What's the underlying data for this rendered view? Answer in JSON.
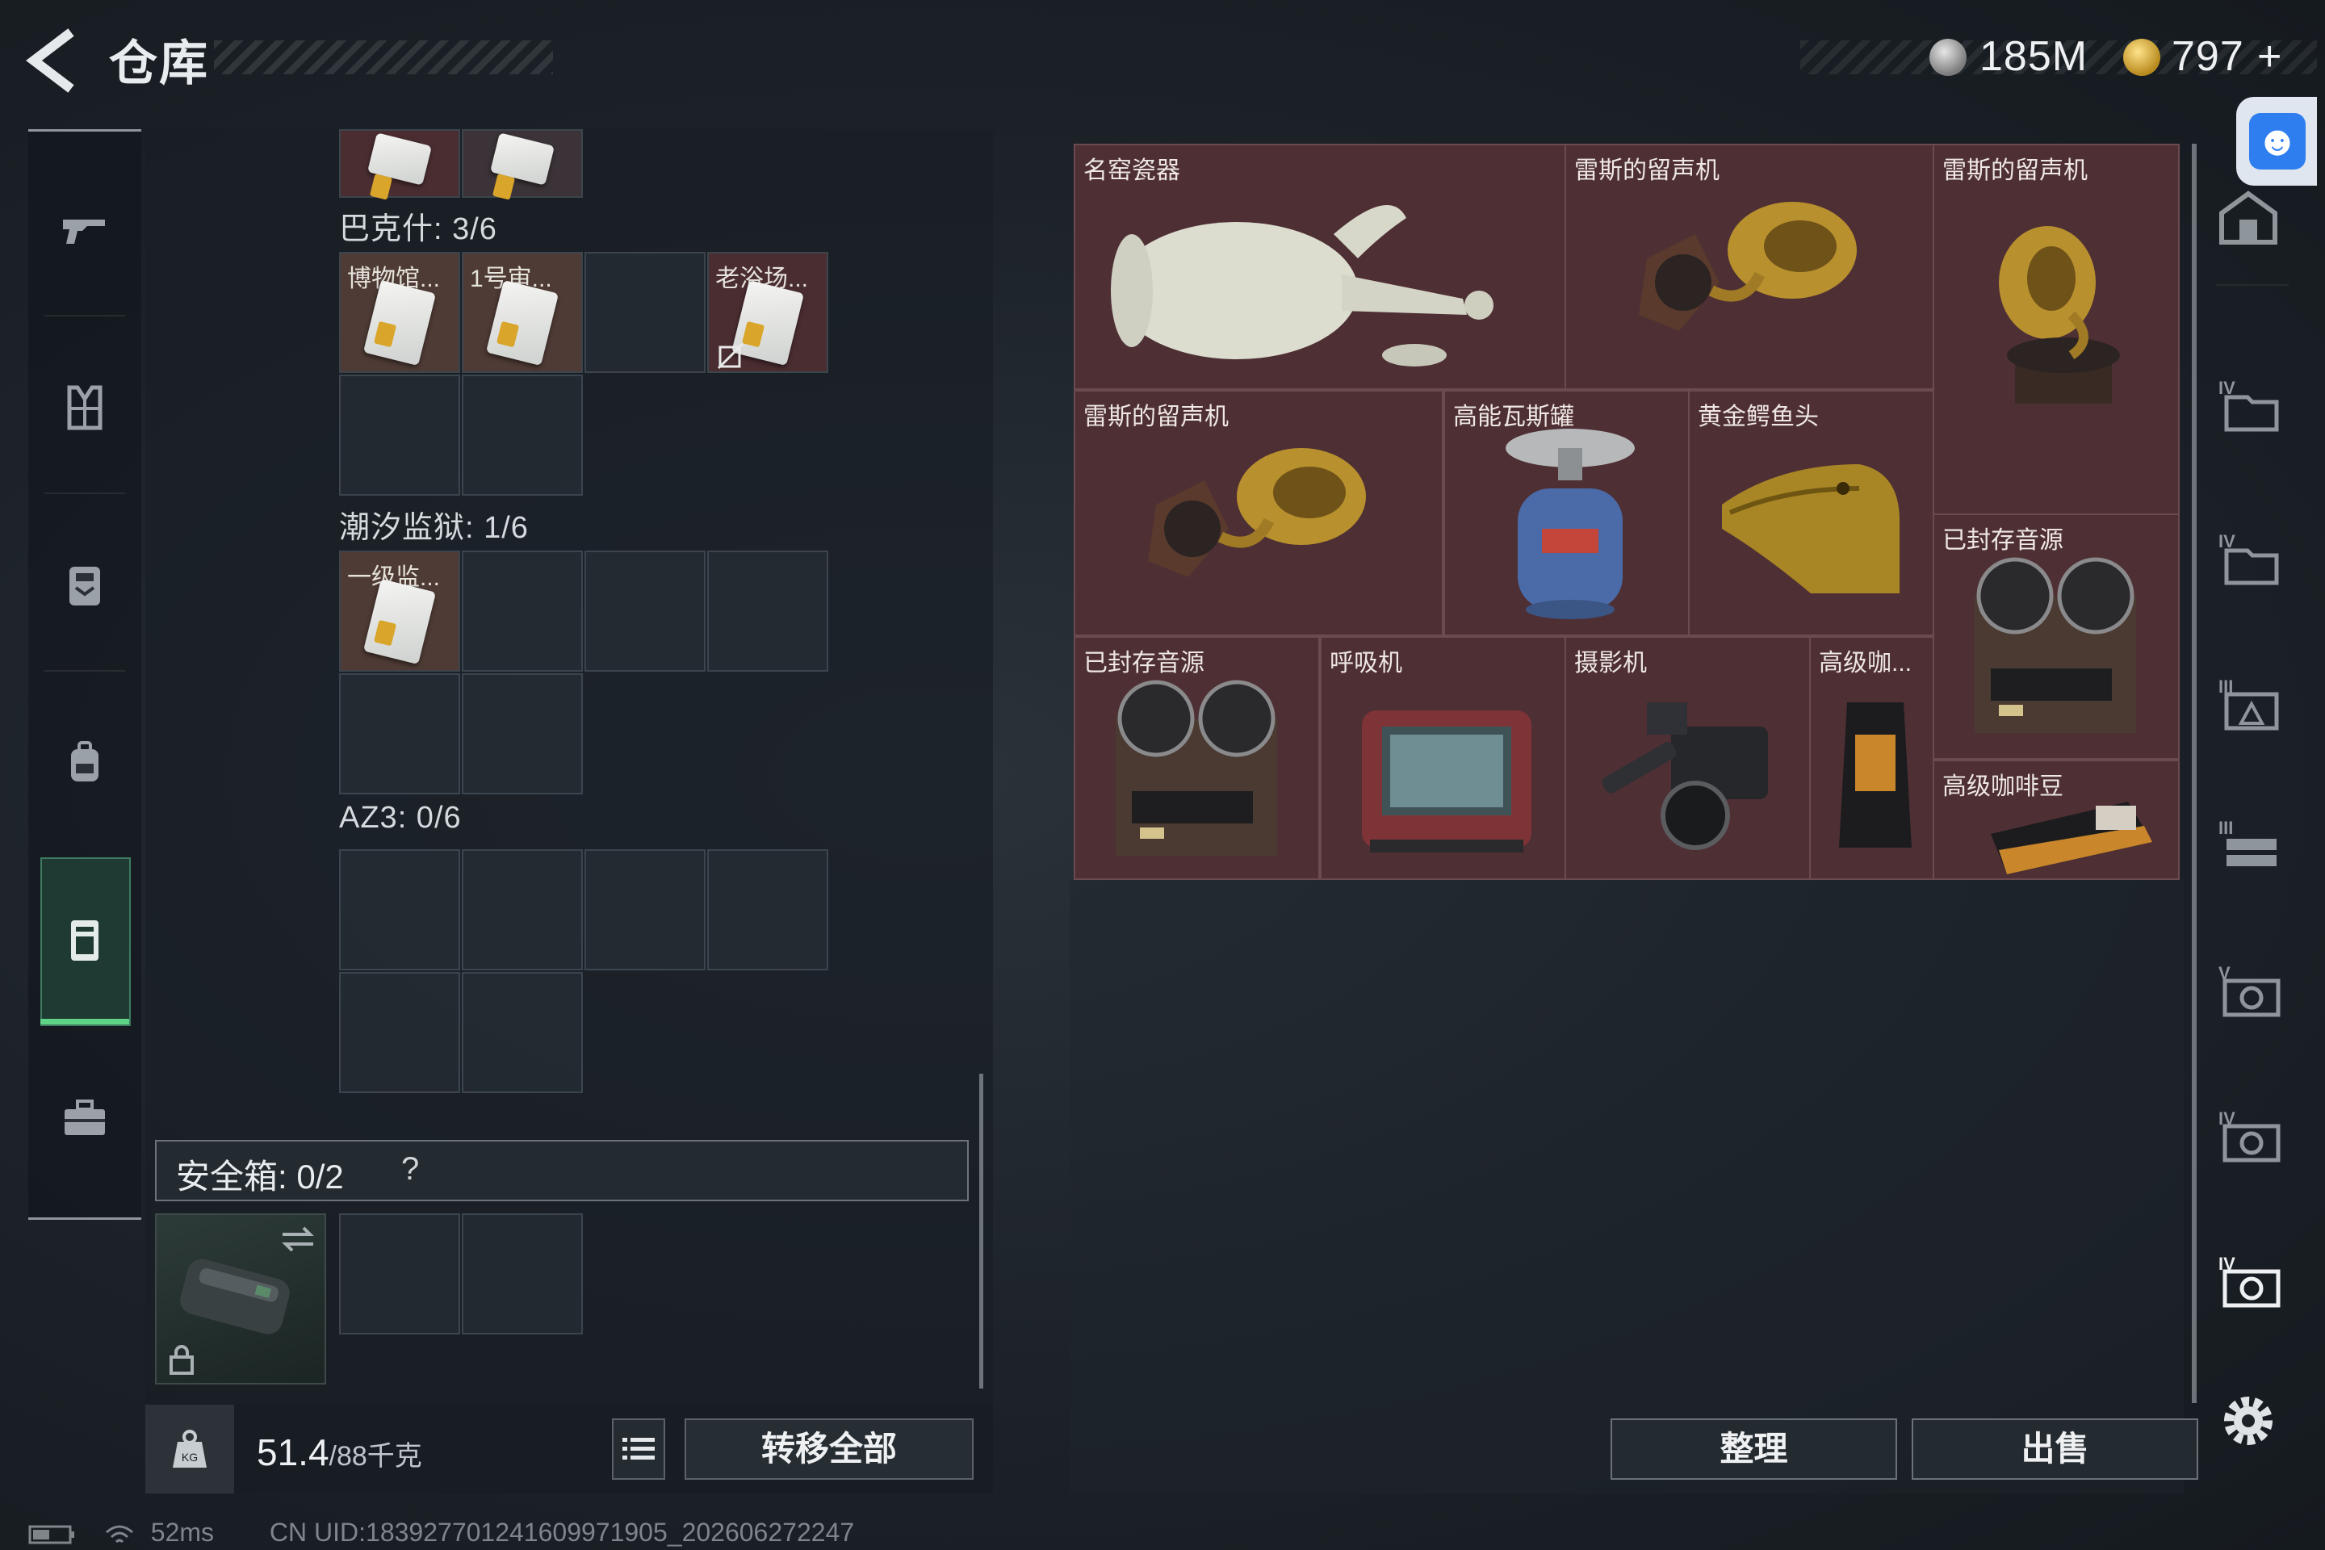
{
  "header": {
    "title": "仓库",
    "back_icon": "back-arrow-icon"
  },
  "currency": [
    {
      "icon": "silver-coin-icon",
      "value": "185M"
    },
    {
      "icon": "gold-coin-icon",
      "value": "797",
      "plus": "+"
    }
  ],
  "left_nav": [
    "gun-icon",
    "armor-vest-icon",
    "chest-rig-icon",
    "backpack-icon",
    "pouch-icon",
    "toolbox-icon"
  ],
  "containers": [
    {
      "name": "巴克什: 3/6",
      "cells": [
        "博物馆...",
        "1号审...",
        "",
        "老浴场..."
      ]
    },
    {
      "name": "潮汐监狱: 1/6",
      "cells": [
        "一级监..."
      ]
    },
    {
      "name": "AZ3: 0/6",
      "cells": []
    }
  ],
  "safe_box": {
    "label": "安全箱:",
    "count": "0/2",
    "help": "?"
  },
  "footer_left": {
    "weight": "51.4",
    "capacity": "/88千克",
    "transfer_all": "转移全部"
  },
  "storage_items": [
    {
      "id": "porcelain",
      "label": "名窑瓷器"
    },
    {
      "id": "gramophone1",
      "label": "雷斯的留声机"
    },
    {
      "id": "gramophone2",
      "label": "雷斯的留声机"
    },
    {
      "id": "gramophone3",
      "label": "雷斯的留声机"
    },
    {
      "id": "gas",
      "label": "高能瓦斯罐"
    },
    {
      "id": "croc",
      "label": "黄金鳄鱼头"
    },
    {
      "id": "reel1",
      "label": "已封存音源"
    },
    {
      "id": "reel2",
      "label": "已封存音源"
    },
    {
      "id": "respirator",
      "label": "呼吸机"
    },
    {
      "id": "camera",
      "label": "摄影机"
    },
    {
      "id": "coffee1",
      "label": "高级咖..."
    },
    {
      "id": "coffee2",
      "label": "高级咖啡豆"
    }
  ],
  "buttons": {
    "sort": "整理",
    "sell": "出售"
  },
  "right_nav": [
    "house-icon",
    "IV",
    "IV",
    "III",
    "III",
    "V",
    "IV",
    "IV"
  ],
  "status": {
    "ping": "52ms",
    "uid": "CN UID:1839277012416099719​05_202606272247"
  },
  "colors": {
    "item_bg": "#4e2f34",
    "active_green": "#5fd486",
    "accessibility_blue": "#2e7ef0"
  }
}
